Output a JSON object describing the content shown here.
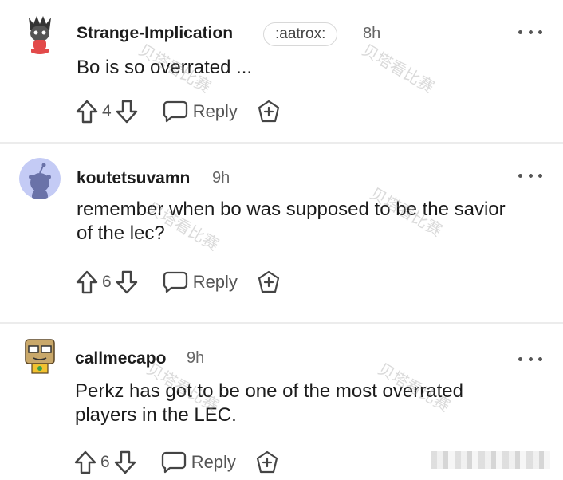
{
  "comments": [
    {
      "username": "Strange-Implication",
      "flair": ":aatrox:",
      "time": "8h",
      "body": "Bo is so overrated ...",
      "score": "4",
      "reply_label": "Reply"
    },
    {
      "username": "koutetsuvamn",
      "time": "9h",
      "body": "remember when bo was supposed to be the savior of the lec?",
      "score": "6",
      "reply_label": "Reply"
    },
    {
      "username": "callmecapo",
      "time": "9h",
      "body": "Perkz has got to be one of the most overrated players in the LEC.",
      "score": "6",
      "reply_label": "Reply"
    }
  ],
  "watermark": "贝塔看比赛",
  "icons": {
    "upvote": "arrow-up-icon",
    "downvote": "arrow-down-icon",
    "reply": "speech-bubble-icon",
    "award": "award-plus-icon",
    "more": "more-dots-icon"
  },
  "colors": {
    "text": "#1c1c1c",
    "muted": "#555555",
    "divider": "#ececec",
    "default_avatar": "#c4cbf5"
  }
}
